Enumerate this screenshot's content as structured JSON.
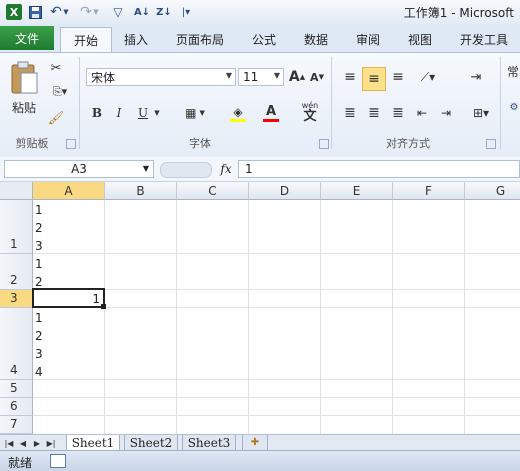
{
  "titlebar": {
    "title": "工作簿1 - Microsoft",
    "icons": [
      "excel-logo-icon",
      "save-icon",
      "undo-icon",
      "dropdown-icon",
      "redo-icon",
      "dropdown-icon",
      "filter-icon",
      "sort-ascending-icon",
      "sort-descending-icon",
      "customize-icon"
    ]
  },
  "tabs": [
    "文件",
    "开始",
    "插入",
    "页面布局",
    "公式",
    "数据",
    "审阅",
    "视图",
    "开发工具"
  ],
  "ribbon": {
    "clipboard": {
      "paste_label": "粘贴",
      "group_label": "剪贴板"
    },
    "font": {
      "font_name": "宋体",
      "font_size": "11",
      "group_label": "字体",
      "bold": "B",
      "italic": "I",
      "underline": "U",
      "grow": "A",
      "shrink": "A",
      "font_color": "A",
      "phonetic": "wén"
    },
    "alignment": {
      "group_label": "对齐方式"
    },
    "partial": "常"
  },
  "formula_bar": {
    "name_box": "A3",
    "fx": "fx",
    "formula": "1"
  },
  "columns": [
    "A",
    "B",
    "C",
    "D",
    "E",
    "F",
    "G"
  ],
  "rows": [
    {
      "label": "1",
      "lines": [
        "1",
        "2",
        "3"
      ]
    },
    {
      "label": "2",
      "lines": [
        "1",
        "2"
      ]
    },
    {
      "label": "3",
      "lines": [],
      "right_value": "1"
    },
    {
      "label": "4",
      "lines": [
        "1",
        "2",
        "3",
        "4"
      ]
    },
    {
      "label": "5",
      "lines": []
    },
    {
      "label": "6",
      "lines": []
    },
    {
      "label": "7",
      "lines": []
    }
  ],
  "sheets": [
    "Sheet1",
    "Sheet2",
    "Sheet3"
  ],
  "active_sheet": "Sheet1",
  "status": {
    "ready": "就绪"
  }
}
